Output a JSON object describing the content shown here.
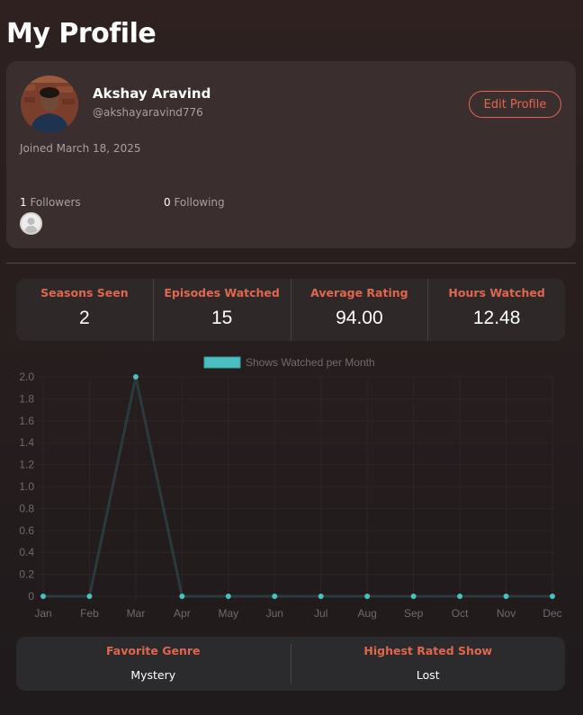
{
  "page": {
    "title": "My Profile"
  },
  "profile": {
    "name": "Akshay Aravind",
    "handle": "@akshayaravind776",
    "edit_label": "Edit Profile",
    "joined": "Joined March 18, 2025",
    "followers_count": "1",
    "followers_label": " Followers",
    "following_count": "0",
    "following_label": " Following"
  },
  "stats": [
    {
      "label": "Seasons Seen",
      "value": "2"
    },
    {
      "label": "Episodes Watched",
      "value": "15"
    },
    {
      "label": "Average Rating",
      "value": "94.00"
    },
    {
      "label": "Hours Watched",
      "value": "12.48"
    }
  ],
  "chart_data": {
    "type": "line",
    "legend": "Shows Watched per Month",
    "categories": [
      "Jan",
      "Feb",
      "Mar",
      "Apr",
      "May",
      "Jun",
      "Jul",
      "Aug",
      "Sep",
      "Oct",
      "Nov",
      "Dec"
    ],
    "series": [
      {
        "name": "Shows Watched per Month",
        "values": [
          0,
          0,
          2,
          0,
          0,
          0,
          0,
          0,
          0,
          0,
          0,
          0
        ]
      }
    ],
    "ylim": [
      0,
      2
    ],
    "yticks": [
      "0",
      "0.2",
      "0.4",
      "0.6",
      "0.8",
      "1.0",
      "1.2",
      "1.4",
      "1.6",
      "1.8",
      "2.0"
    ],
    "grid": true,
    "legend_position": "top",
    "colors": {
      "point": "#4bc0c0",
      "line": "#2b3a3d",
      "legend": "#4bc0c0"
    }
  },
  "favorites": {
    "genre_label": "Favorite Genre",
    "genre_value": "Mystery",
    "show_label": "Highest Rated Show",
    "show_value": "Lost"
  }
}
